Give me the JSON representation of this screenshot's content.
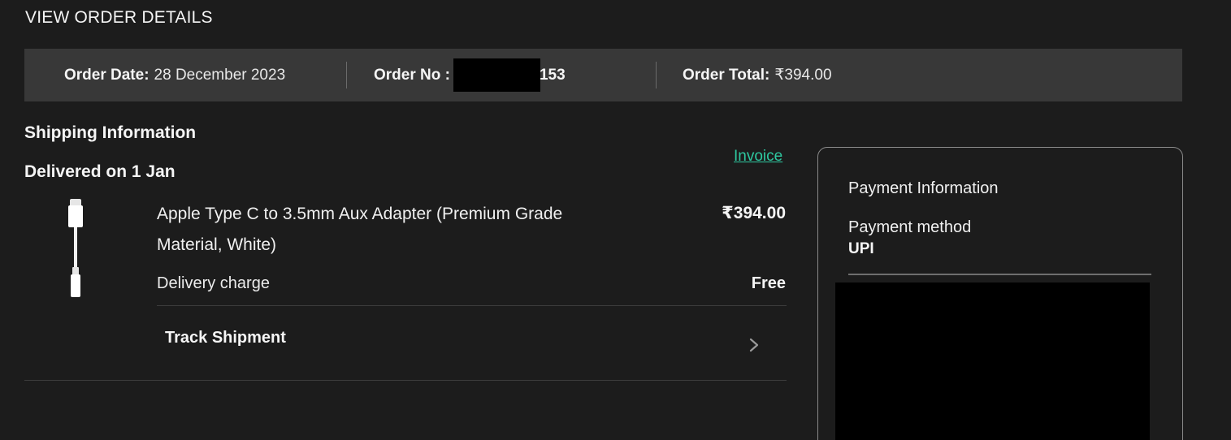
{
  "page": {
    "title": "VIEW ORDER DETAILS"
  },
  "summary": {
    "order_date_label": "Order Date:",
    "order_date_value": "28 December 2023",
    "order_no_label": "Order No :",
    "order_no_visible_suffix": "153",
    "order_total_label": "Order Total:",
    "order_total_value": "₹394.00"
  },
  "shipping": {
    "section_title": "Shipping Information",
    "invoice_link": "Invoice",
    "delivery_status": "Delivered on 1 Jan",
    "product": {
      "image_icon": "usb-c-audio-adapter-image",
      "name": "Apple Type C to 3.5mm Aux Adapter (Premium Grade Material, White)",
      "price": "₹394.00"
    },
    "delivery_charge_label": "Delivery charge",
    "delivery_charge_value": "Free",
    "track_shipment_label": "Track Shipment",
    "track_icon": "chevron-right-icon"
  },
  "payment": {
    "title": "Payment Information",
    "method_label": "Payment method",
    "method_value": "UPI"
  },
  "colors": {
    "background": "#1c1c1c",
    "summary_bar": "#383838",
    "accent_link": "#2ec8a0",
    "redaction": "#000000"
  }
}
